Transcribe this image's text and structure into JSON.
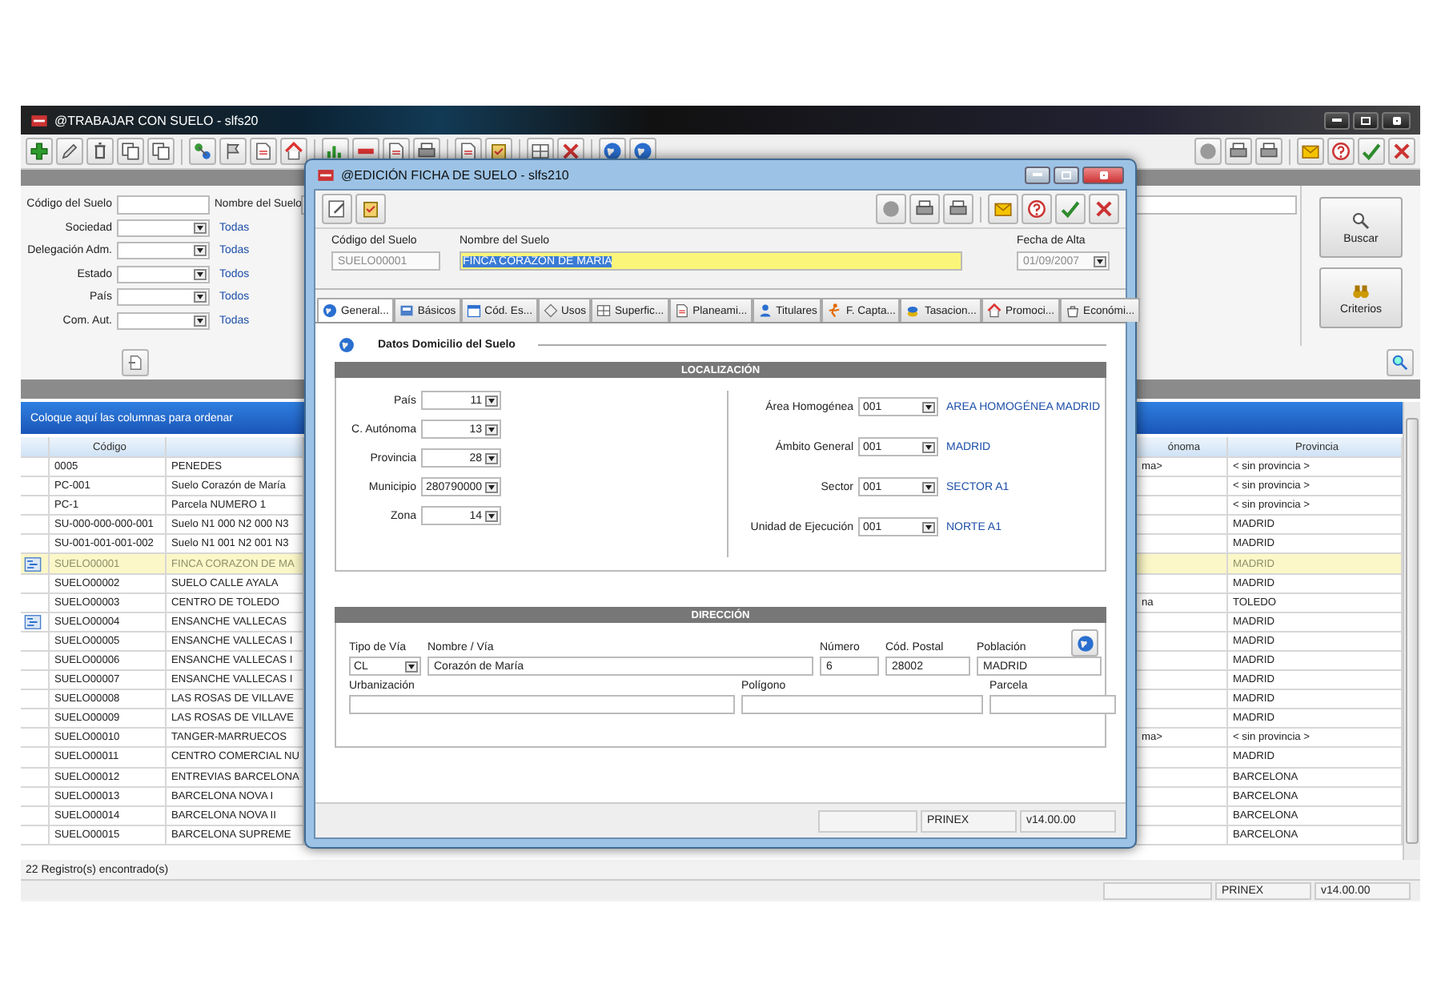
{
  "main_window": {
    "title": "@TRABAJAR CON SUELO - slfs20",
    "filters": [
      {
        "label": "Código del Suelo",
        "kind": "text"
      },
      {
        "label": "Sociedad",
        "kind": "select",
        "value": "Todas"
      },
      {
        "label": "Delegación Adm.",
        "kind": "select",
        "value": "Todas"
      },
      {
        "label": "Estado",
        "kind": "select",
        "value": "Todos"
      },
      {
        "label": "País",
        "kind": "select",
        "value": "Todos"
      },
      {
        "label": "Com. Aut.",
        "kind": "select",
        "value": "Todas"
      }
    ],
    "name_filter": {
      "label": "Nombre del Suelo"
    },
    "buttons": [
      {
        "label": "Buscar",
        "kind": "search"
      },
      {
        "label": "Criterios",
        "kind": "criteria"
      }
    ],
    "grid": {
      "group_hint": "Coloque aquí las columnas para ordenar",
      "columns": {
        "codigo": "Código",
        "autonomia": "ónoma",
        "provincia": "Provincia"
      },
      "rows": [
        {
          "codigo": "0005",
          "nombre": "PENEDES",
          "autonomia": "ma>",
          "provincia": "< sin provincia >",
          "selected": false,
          "flagged": false
        },
        {
          "codigo": "PC-001",
          "nombre": "Suelo Corazón de María",
          "provincia": "< sin provincia >",
          "selected": false,
          "flagged": false
        },
        {
          "codigo": "PC-1",
          "nombre": "Parcela  NUMERO 1",
          "provincia": "< sin provincia >",
          "selected": false,
          "flagged": false
        },
        {
          "codigo": "SU-000-000-000-001",
          "nombre": "Suelo  N1 000 N2 000 N3",
          "provincia": "MADRID",
          "selected": false,
          "flagged": false
        },
        {
          "codigo": "SU-001-001-001-002",
          "nombre": "Suelo  N1 001 N2 001 N3",
          "provincia": "MADRID",
          "selected": false,
          "flagged": false
        },
        {
          "codigo": "SUELO00001",
          "nombre": "FINCA CORAZON DE MA",
          "provincia": "MADRID",
          "selected": true,
          "flagged": true
        },
        {
          "codigo": "SUELO00002",
          "nombre": "SUELO CALLE AYALA",
          "provincia": "MADRID",
          "selected": false,
          "flagged": false
        },
        {
          "codigo": "SUELO00003",
          "nombre": "CENTRO DE TOLEDO",
          "autonomia": "na",
          "provincia": "TOLEDO",
          "selected": false,
          "flagged": false
        },
        {
          "codigo": "SUELO00004",
          "nombre": "ENSANCHE VALLECAS",
          "provincia": "MADRID",
          "selected": false,
          "flagged": true
        },
        {
          "codigo": "SUELO00005",
          "nombre": "ENSANCHE VALLECAS I",
          "provincia": "MADRID",
          "selected": false,
          "flagged": false
        },
        {
          "codigo": "SUELO00006",
          "nombre": "ENSANCHE VALLECAS I",
          "provincia": "MADRID",
          "selected": false,
          "flagged": false
        },
        {
          "codigo": "SUELO00007",
          "nombre": "ENSANCHE VALLECAS I",
          "provincia": "MADRID",
          "selected": false,
          "flagged": false
        },
        {
          "codigo": "SUELO00008",
          "nombre": "LAS ROSAS DE VILLAVE",
          "provincia": "MADRID",
          "selected": false,
          "flagged": false
        },
        {
          "codigo": "SUELO00009",
          "nombre": "LAS ROSAS DE VILLAVE",
          "provincia": "MADRID",
          "selected": false,
          "flagged": false
        },
        {
          "codigo": "SUELO00010",
          "nombre": "TANGER-MARRUECOS",
          "autonomia": "ma>",
          "provincia": "< sin provincia >",
          "selected": false,
          "flagged": false
        },
        {
          "codigo": "SUELO00011",
          "nombre": "CENTRO COMERCIAL NU",
          "provincia": "MADRID",
          "selected": false,
          "flagged": false
        },
        {
          "codigo": "SUELO00012",
          "nombre": "ENTREVIAS BARCELONA",
          "provincia": "BARCELONA",
          "selected": false,
          "flagged": false
        },
        {
          "codigo": "SUELO00013",
          "nombre": "BARCELONA NOVA I",
          "provincia": "BARCELONA",
          "selected": false,
          "flagged": false
        },
        {
          "codigo": "SUELO00014",
          "nombre": "BARCELONA NOVA II",
          "provincia": "BARCELONA",
          "selected": false,
          "flagged": false
        },
        {
          "codigo": "SUELO00015",
          "nombre": "BARCELONA SUPREME",
          "provincia": "BARCELONA",
          "selected": false,
          "flagged": false
        }
      ]
    },
    "record_count": "22 Registro(s) encontrado(s)",
    "status_bar": [
      "PRINEX",
      "v14.00.00"
    ]
  },
  "dialog": {
    "title": "@EDICIÓN FICHA DE SUELO - slfs210",
    "codigo": {
      "label": "Código del Suelo",
      "value": "SUELO00001",
      "disabled": true
    },
    "nombre": {
      "label": "Nombre del Suelo",
      "value": "FINCA CORAZON DE MARIA"
    },
    "fecha": {
      "label": "Fecha de Alta",
      "value": "01/09/2007",
      "disabled": true
    },
    "tabs": [
      {
        "label": "General...",
        "selected": true
      },
      {
        "label": "Básicos",
        "selected": false
      },
      {
        "label": "Cód. Es...",
        "selected": false
      },
      {
        "label": "Usos",
        "selected": false
      },
      {
        "label": "Superfic...",
        "selected": false
      },
      {
        "label": "Planeami...",
        "selected": false
      },
      {
        "label": "Titulares",
        "selected": false
      },
      {
        "label": "F. Capta...",
        "selected": false
      },
      {
        "label": "Tasacion...",
        "selected": false
      },
      {
        "label": "Promoci...",
        "selected": false
      },
      {
        "label": "Económi...",
        "selected": false
      }
    ],
    "heading": "Datos Domicilio del Suelo",
    "localizacion": {
      "title": "LOCALIZACIÓN",
      "left": [
        {
          "label": "País",
          "value": "11"
        },
        {
          "label": "C. Autónoma",
          "value": "13"
        },
        {
          "label": "Provincia",
          "value": "28"
        },
        {
          "label": "Municipio",
          "value": "280790000"
        },
        {
          "label": "Zona",
          "value": "14"
        }
      ],
      "right": [
        {
          "label": "Área Homogénea",
          "value": "001",
          "name": "AREA HOMOGÉNEA MADRID"
        },
        {
          "label": "Ámbito General",
          "value": "001",
          "name": "MADRID"
        },
        {
          "label": "Sector",
          "value": "001",
          "name": "SECTOR A1"
        },
        {
          "label": "Unidad de Ejecución",
          "value": "001",
          "name": "NORTE A1"
        }
      ]
    },
    "direccion": {
      "title": "DIRECCIÓN",
      "row1": [
        {
          "label": "Tipo de Vía",
          "value": "CL",
          "kind": "select"
        },
        {
          "label": "Nombre / Vía",
          "value": "Corazón de María",
          "kind": "text"
        },
        {
          "label": "Número",
          "value": "6",
          "kind": "text"
        },
        {
          "label": "Cód. Postal",
          "value": "28002",
          "kind": "text"
        },
        {
          "label": "Población",
          "value": "MADRID",
          "kind": "text"
        }
      ],
      "row2": [
        {
          "label": "Urbanización",
          "kind": "text"
        },
        {
          "label": "Polígono",
          "kind": "text"
        },
        {
          "label": "Parcela",
          "kind": "text"
        }
      ]
    },
    "status_bar": [
      "PRINEX",
      "v14.00.00"
    ]
  }
}
